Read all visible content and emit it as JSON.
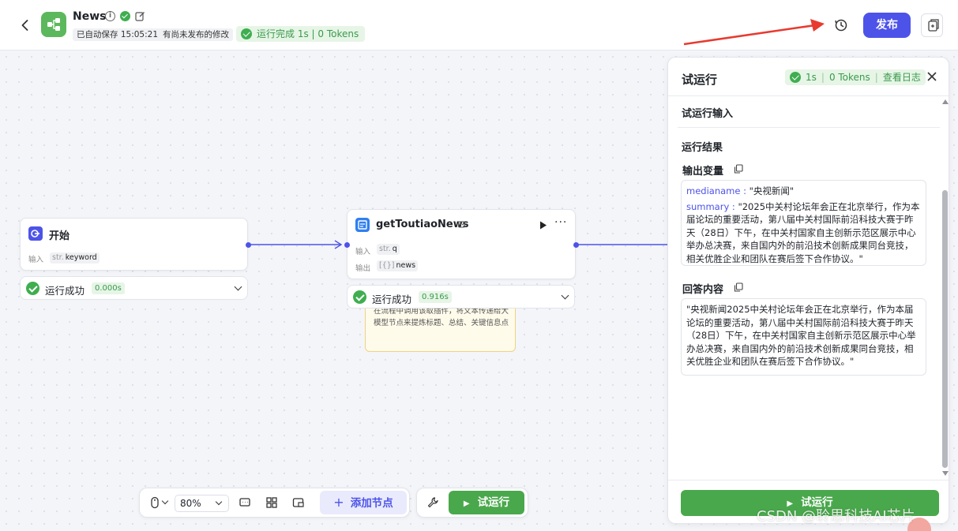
{
  "header": {
    "back_icon": "chevron-left-icon",
    "app_name": "News",
    "autosave": "已自动保存 15:05:21",
    "unpublished": "有尚未发布的修改",
    "run_status": "运行完成 1s | 0 Tokens",
    "publish_label": "发布",
    "colors": {
      "publish": "#4d53e8",
      "success": "#3fae50",
      "app_icon": "#5cb85c"
    }
  },
  "nodes": {
    "start": {
      "title": "开始",
      "input_label": "输入",
      "input_type": "str.",
      "input_value": "keyword",
      "status": "运行成功",
      "time": "0.000s"
    },
    "plugin": {
      "title": "getToutiaoNews",
      "input_label": "输入",
      "input_type": "str.",
      "input_value": "q",
      "output_label": "输出",
      "output_type": "[{}]",
      "output_value": "news",
      "status": "运行成功",
      "time": "0.916s",
      "note": "在流程中调用该取插件，将文本传递给大模型节点来提炼标题、总结、关键信息点"
    }
  },
  "toolbar": {
    "zoom": "80%",
    "add_node": "添加节点",
    "trial_run": "试运行"
  },
  "panel": {
    "title": "试运行",
    "status_time": "1s",
    "status_tokens": "0 Tokens",
    "view_log": "查看日志",
    "input_section": "试运行输入",
    "result_section": "运行结果",
    "output_vars_title": "输出变量",
    "output_vars": {
      "mediename_key": "medianame :",
      "mediename_val": "\"央视新闻\"",
      "summary_key": "summary :",
      "summary_val": "\"2025中关村论坛年会正在北京举行，作为本届论坛的重要活动，第八届中关村国际前沿科技大赛于昨天（28日）下午，在中关村国家自主创新示范区展示中心举办总决赛，来自国内外的前沿技术创新成果同台竞技，相关优胜企业和团队在赛后签下合作协议。\""
    },
    "answer_title": "回答内容",
    "answer": "\"央视新闻2025中关村论坛年会正在北京举行，作为本届论坛的重要活动，第八届中关村国际前沿科技大赛于昨天（28日）下午，在中关村国家自主创新示范区展示中心举办总决赛，来自国内外的前沿技术创新成果同台竞技，相关优胜企业和团队在赛后签下合作协议。\"",
    "run_button": "试运行"
  },
  "watermark": "CSDN @聆思科技AI芯片"
}
